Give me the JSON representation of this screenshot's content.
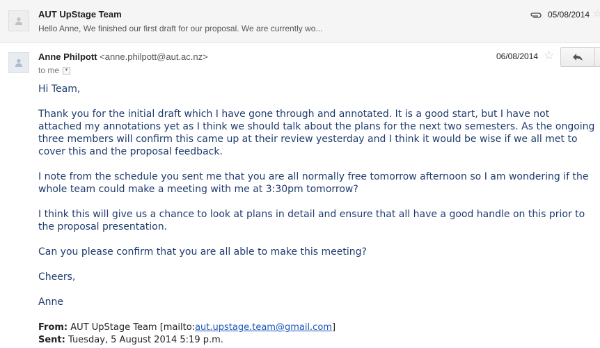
{
  "collapsed_message": {
    "sender": "AUT UpStage Team",
    "snippet": "Hello Anne, We finished our first draft for our proposal. We are currently wo...",
    "date": "05/08/2014",
    "icons": [
      "person-icon",
      "paperclip-icon",
      "star-icon"
    ]
  },
  "message": {
    "sender_name": "Anne Philpott",
    "sender_email": "<anne.philpott@aut.ac.nz>",
    "recipient": "to me",
    "date": "06/08/2014",
    "icons": [
      "person-icon",
      "star-icon",
      "reply-icon",
      "chevron-down-icon"
    ],
    "body": [
      "Hi Team,",
      "Thank you for the initial draft which I have gone through and annotated. It is a good start, but I have not attached my annotations yet as I think we should talk about the plans for the next two semesters. As the ongoing three members will confirm this came up at their review yesterday and I think it would be wise if we all met to cover this and the proposal feedback.",
      "I note from the schedule you sent me that you are all normally free tomorrow afternoon so I am wondering if the whole team could make a meeting with me at 3:30pm tomorrow?",
      "I think this will give us a chance to look at plans in detail and ensure that all have a good handle on this prior to the proposal presentation.",
      "Can you please confirm that you are all able to make this meeting?",
      "Cheers,",
      "Anne"
    ],
    "quoted": {
      "from_label": "From:",
      "from_name": "AUT UpStage Team [mailto:",
      "from_email": "aut.upstage.team@gmail.com",
      "from_close": "]",
      "sent_label": "Sent:",
      "sent_value": "Tuesday, 5 August 2014 5:19 p.m."
    }
  },
  "colors": {
    "body_text": "#1f3c6e",
    "link": "#1a55b8",
    "collapsed_bg": "#f5f5f5"
  }
}
